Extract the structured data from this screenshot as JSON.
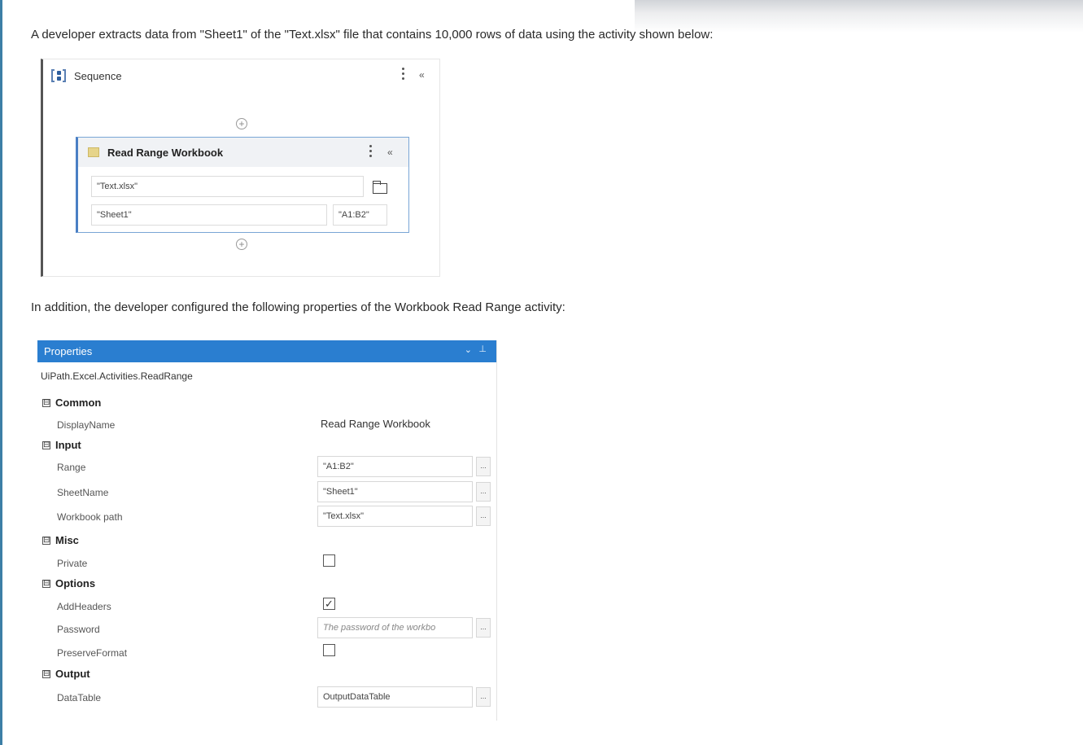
{
  "intro_text": "A developer extracts data from \"Sheet1\" of the \"Text.xlsx\" file that contains 10,000 rows of data using the activity shown below:",
  "second_text": "In addition, the developer configured the following properties of the Workbook Read Range activity:",
  "designer": {
    "sequence_title": "Sequence",
    "activity_title": "Read Range Workbook",
    "workbook_path": "\"Text.xlsx\"",
    "sheet_name": "\"Sheet1\"",
    "range": "\"A1:B2\""
  },
  "properties": {
    "header": "Properties",
    "activity_type": "UiPath.Excel.Activities.ReadRange",
    "categories": {
      "common": "Common",
      "input": "Input",
      "misc": "Misc",
      "options": "Options",
      "output": "Output"
    },
    "rows": {
      "display_name": {
        "label": "DisplayName",
        "value": "Read Range Workbook"
      },
      "range": {
        "label": "Range",
        "value": "\"A1:B2\""
      },
      "sheet_name": {
        "label": "SheetName",
        "value": "\"Sheet1\""
      },
      "workbook_path": {
        "label": "Workbook path",
        "value": "\"Text.xlsx\""
      },
      "private": {
        "label": "Private",
        "checked": false
      },
      "add_headers": {
        "label": "AddHeaders",
        "checked": true,
        "mark": "✓"
      },
      "password": {
        "label": "Password",
        "placeholder": "The password of the workbo"
      },
      "preserve_format": {
        "label": "PreserveFormat",
        "checked": false
      },
      "data_table": {
        "label": "DataTable",
        "value": "OutputDataTable"
      }
    },
    "ellipsis_label": "...",
    "collapse_symbol": "⊟"
  },
  "icons": {
    "plus": "+",
    "collapse_chevron": "«",
    "dropdown": "⌄",
    "pin": "⊥"
  },
  "colors": {
    "properties_header": "#2a7ed0",
    "activity_border": "#4a7fc4"
  }
}
